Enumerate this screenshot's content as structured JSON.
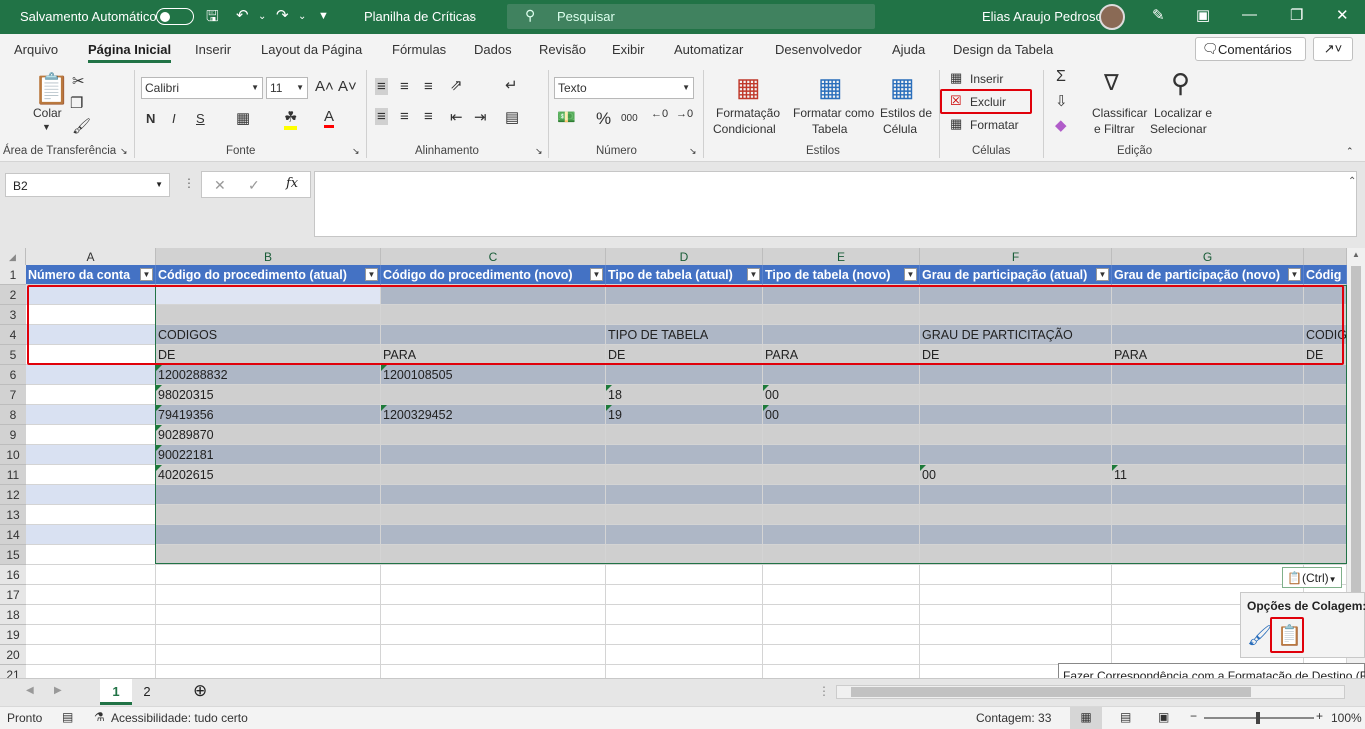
{
  "titlebar": {
    "autosave": "Salvamento Automático",
    "doc_title": "Planilha de Críticas",
    "search_placeholder": "Pesquisar",
    "user": "Elias Araujo Pedroso"
  },
  "tabs": [
    "Arquivo",
    "Página Inicial",
    "Inserir",
    "Layout da Página",
    "Fórmulas",
    "Dados",
    "Revisão",
    "Exibir",
    "Automatizar",
    "Desenvolvedor",
    "Ajuda",
    "Design da Tabela"
  ],
  "comments_label": "Comentários",
  "ribbon": {
    "clipboard": {
      "paste": "Colar",
      "group": "Área de Transferência"
    },
    "font": {
      "name": "Calibri",
      "size": "11",
      "bold": "N",
      "italic": "I",
      "underline": "S",
      "group": "Fonte"
    },
    "alignment": {
      "group": "Alinhamento"
    },
    "number": {
      "format": "Texto",
      "percent": "%",
      "thousands": "000",
      "group": "Número"
    },
    "styles": {
      "cond_format_1": "Formatação",
      "cond_format_2": "Condicional",
      "format_table_1": "Formatar como",
      "format_table_2": "Tabela",
      "cell_styles_1": "Estilos de",
      "cell_styles_2": "Célula",
      "group": "Estilos"
    },
    "cells": {
      "insert": "Inserir",
      "delete": "Excluir",
      "format": "Formatar",
      "group": "Células"
    },
    "editing": {
      "sort_1": "Classificar",
      "sort_2": "e Filtrar",
      "find_1": "Localizar e",
      "find_2": "Selecionar",
      "group": "Edição"
    }
  },
  "namebox": "B2",
  "columns": [
    "A",
    "B",
    "C",
    "D",
    "E",
    "F",
    "G",
    ""
  ],
  "rows": [
    "1",
    "2",
    "3",
    "4",
    "5",
    "6",
    "7",
    "8",
    "9",
    "10",
    "11",
    "12",
    "13",
    "14",
    "15",
    "16",
    "17",
    "18",
    "19",
    "20",
    "21"
  ],
  "table_headers": [
    "Número da conta",
    "Código do procedimento (atual)",
    "Código do procedimento (novo)",
    "Tipo de tabela (atual)",
    "Tipo de tabela (novo)",
    "Grau de participação (atual)",
    "Grau de participação (novo)",
    "Códig"
  ],
  "cells": {
    "r4": [
      "",
      "CODIGOS",
      "",
      "TIPO DE TABELA",
      "",
      "GRAU DE PARTICITAÇÃO",
      "",
      "CODIG"
    ],
    "r5": [
      "",
      "DE",
      "PARA",
      "DE",
      "PARA",
      "DE",
      "PARA",
      "DE"
    ],
    "r6": [
      "",
      "1200288832",
      "1200108505",
      "",
      "",
      "",
      "",
      ""
    ],
    "r7": [
      "",
      "98020315",
      "",
      "18",
      "00",
      "",
      "",
      ""
    ],
    "r8": [
      "",
      "79419356",
      "1200329452",
      "19",
      "00",
      "",
      "",
      ""
    ],
    "r9": [
      "",
      "90289870",
      "",
      "",
      "",
      "",
      "",
      ""
    ],
    "r10": [
      "",
      "90022181",
      "",
      "",
      "",
      "",
      "",
      ""
    ],
    "r11": [
      "",
      "40202615",
      "",
      "",
      "",
      "00",
      "11",
      ""
    ]
  },
  "paste_ctrl": "(Ctrl)",
  "paste_options_title": "Opções de Colagem:",
  "tooltip": "Fazer Correspondência com a Formatação de Destino (F)",
  "sheets": [
    "1",
    "2"
  ],
  "status": {
    "ready": "Pronto",
    "accessibility": "Acessibilidade: tudo certo",
    "count": "Contagem: 33",
    "zoom": "100%"
  }
}
